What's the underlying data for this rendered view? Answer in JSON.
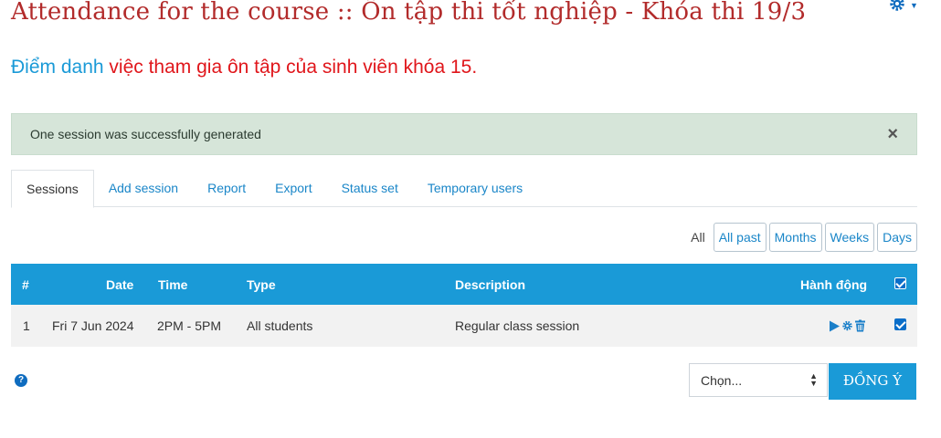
{
  "page_title": "Attendance for the course :: Ôn tập thi tốt nghiệp - Khóa thi 19/3",
  "intro": {
    "highlight": "Điểm danh",
    "rest": " việc tham gia ôn tập của sinh viên khóa 15."
  },
  "alert": {
    "message": "One session was successfully generated",
    "close_label": "×"
  },
  "tabs": [
    "Sessions",
    "Add session",
    "Report",
    "Export",
    "Status set",
    "Temporary users"
  ],
  "active_tab": "Sessions",
  "filters": {
    "current": "All",
    "buttons": [
      "All past",
      "Months",
      "Weeks",
      "Days"
    ]
  },
  "table": {
    "headers": {
      "num": "#",
      "date": "Date",
      "time": "Time",
      "type": "Type",
      "description": "Description",
      "actions": "Hành động"
    },
    "rows": [
      {
        "num": "1",
        "date": "Fri 7 Jun 2024",
        "time": "2PM - 5PM",
        "type": "All students",
        "description": "Regular class session"
      }
    ]
  },
  "bottom": {
    "select_value": "Chọn...",
    "submit_label": "ĐỒNG Ý"
  },
  "colors": {
    "title": "#b22b2b",
    "accent": "#1a9ad7",
    "alert_bg": "#d6e5d9"
  }
}
